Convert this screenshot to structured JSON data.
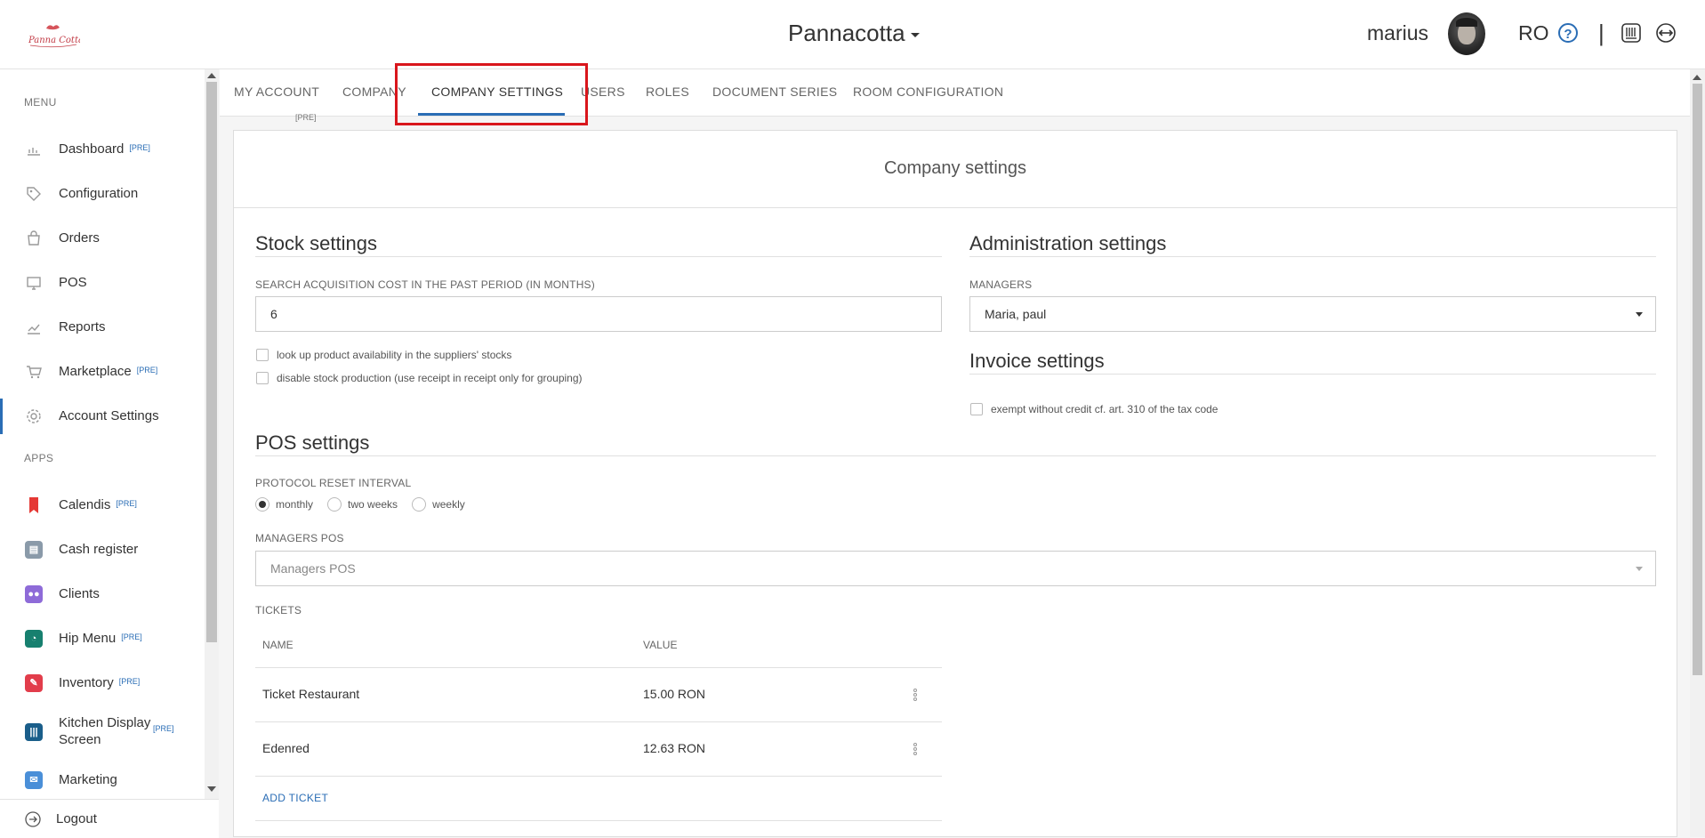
{
  "header": {
    "company": "Pannacotta",
    "user": "marius",
    "lang": "RO",
    "help_glyph": "?",
    "separator": "|"
  },
  "sidebar": {
    "menu_title": "MENU",
    "apps_title": "APPS",
    "pre_badge": "[PRE]",
    "menu_items": [
      {
        "label": "Dashboard",
        "icon": "chart-icon",
        "pre": true
      },
      {
        "label": "Configuration",
        "icon": "tag-icon",
        "pre": false
      },
      {
        "label": "Orders",
        "icon": "bag-icon",
        "pre": false
      },
      {
        "label": "POS",
        "icon": "monitor-icon",
        "pre": false
      },
      {
        "label": "Reports",
        "icon": "report-icon",
        "pre": false
      },
      {
        "label": "Marketplace",
        "icon": "cart-icon",
        "pre": true
      },
      {
        "label": "Account Settings",
        "icon": "gear-icon",
        "pre": false,
        "active": true
      }
    ],
    "app_items": [
      {
        "label": "Calendis",
        "icon": "bookmark-icon",
        "pre": true,
        "color": "#e53935"
      },
      {
        "label": "Cash register",
        "icon": "cash-register-icon",
        "pre": false,
        "color": "#8a9aa9"
      },
      {
        "label": "Clients",
        "icon": "clients-icon",
        "pre": false,
        "color": "#8e6bd8"
      },
      {
        "label": "Hip Menu",
        "icon": "hip-menu-icon",
        "pre": true,
        "color": "#17806f"
      },
      {
        "label": "Inventory",
        "icon": "inventory-icon",
        "pre": true,
        "color": "#e23d4b"
      },
      {
        "label": "Kitchen Display Screen",
        "icon": "utensils-icon",
        "pre": true,
        "color": "#1a5e8a"
      },
      {
        "label": "Marketing",
        "icon": "marketing-icon",
        "pre": false,
        "color": "#4a8fd8"
      }
    ],
    "logout": "Logout"
  },
  "tabs": [
    {
      "label": "MY ACCOUNT"
    },
    {
      "label": "COMPANY"
    },
    {
      "label": "COMPANY SETTINGS",
      "active": true
    },
    {
      "label": "USERS"
    },
    {
      "label": "ROLES"
    },
    {
      "label": "DOCUMENT SERIES"
    },
    {
      "label": "ROOM CONFIGURATION"
    }
  ],
  "tab_pre": "[PRE]",
  "panel": {
    "title": "Company settings",
    "stock": {
      "title": "Stock settings",
      "acq_label": "SEARCH ACQUISITION COST IN THE PAST PERIOD (IN MONTHS)",
      "acq_value": "6",
      "chk1": "look up product availability in the suppliers' stocks",
      "chk2": "disable stock production (use receipt in receipt only for grouping)"
    },
    "admin": {
      "title": "Administration settings",
      "managers_label": "MANAGERS",
      "managers_value": "Maria, paul"
    },
    "invoice": {
      "title": "Invoice settings",
      "chk": "exempt without credit cf. art. 310 of the tax code"
    },
    "pos": {
      "title": "POS settings",
      "protocol_label": "PROTOCOL RESET INTERVAL",
      "radios": [
        "monthly",
        "two weeks",
        "weekly"
      ],
      "selected_radio": "monthly",
      "managers_pos_label": "MANAGERS POS",
      "managers_pos_placeholder": "Managers POS",
      "tickets_label": "TICKETS",
      "col_name": "NAME",
      "col_value": "VALUE",
      "tickets": [
        {
          "name": "Ticket Restaurant",
          "value": "15.00 RON"
        },
        {
          "name": "Edenred",
          "value": "12.63 RON"
        }
      ],
      "add_ticket": "ADD TICKET"
    }
  }
}
